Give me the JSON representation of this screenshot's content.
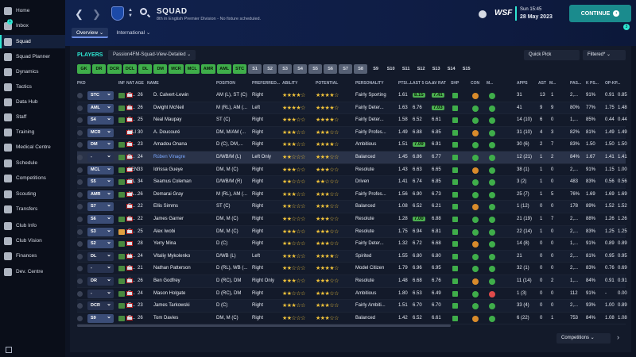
{
  "sidebar": {
    "items": [
      {
        "label": "Home"
      },
      {
        "label": "Inbox"
      },
      {
        "label": "Squad"
      },
      {
        "label": "Squad Planner"
      },
      {
        "label": "Dynamics"
      },
      {
        "label": "Tactics"
      },
      {
        "label": "Data Hub"
      },
      {
        "label": "Staff"
      },
      {
        "label": "Training"
      },
      {
        "label": "Medical Centre"
      },
      {
        "label": "Schedule"
      },
      {
        "label": "Competitions"
      },
      {
        "label": "Scouting"
      },
      {
        "label": "Transfers"
      },
      {
        "label": "Club Info"
      },
      {
        "label": "Club Vision"
      },
      {
        "label": "Finances"
      },
      {
        "label": "Dev. Centre"
      }
    ],
    "active": "Squad",
    "inbox_badge": "1"
  },
  "header": {
    "title": "SQUAD",
    "subtitle": "8th in English Premier Division - No fixture scheduled.",
    "tabs": [
      {
        "label": "Overview ⌄"
      },
      {
        "label": "International ⌄"
      }
    ],
    "logo_text": "WSF",
    "date_time": "Sun 15:45",
    "date": "28 May 2023",
    "continue_label": "CONTINUE",
    "notif_count": "3"
  },
  "toolbar": {
    "players_label": "PLAYERS",
    "view_name": "Passion4FM-Squad-View-Detailed ⌄",
    "quick_pick": "Quick Pick",
    "filtered": "Filtered* ⌄"
  },
  "position_chips": [
    "GK",
    "DR",
    "DCR",
    "DCL",
    "DL",
    "DM",
    "MCR",
    "MCL",
    "AMR",
    "AML",
    "STC",
    "S1",
    "S2",
    "S3",
    "S4",
    "S5",
    "S6",
    "S7",
    "S8",
    "S9",
    "S10",
    "S11",
    "S12",
    "S13",
    "S14",
    "S15"
  ],
  "columns": [
    "PKD",
    "INF",
    "NAT",
    "AGE",
    "NAME",
    "POSITION",
    "PREFERRED...",
    "ABILITY",
    "POTENTIAL",
    "PERSONALITY",
    "PTS/...",
    "LAST 5 GA...",
    "AV RAT",
    "SHP",
    "CON",
    "M...",
    "APPS",
    "AST",
    "M...",
    "PAS...",
    "K PS...",
    "OP-KP..."
  ],
  "players": [
    {
      "pkd": "STC",
      "nat": "E...",
      "age": "26",
      "name": "D. Calvert-Lewin",
      "pos": "AM (L), ST (C)",
      "foot": "Right",
      "abil": "★★★★☆",
      "pot": "★★★★☆",
      "pers": "Fairly Sporting",
      "pts": "1.61",
      "last5": "8.15",
      "avr": "7.41",
      "apps": "31",
      "ast": "13",
      "m": "1",
      "pas": "2,...",
      "kps": "91%",
      "op": "0.91",
      "op2": "0.85"
    },
    {
      "pkd": "AML",
      "nat": "E...",
      "age": "26",
      "name": "Dwight McNeil",
      "pos": "M (RL), AM (...",
      "foot": "Left",
      "abil": "★★★★☆",
      "pot": "★★★★☆",
      "pers": "Fairly Deter...",
      "pts": "1.63",
      "last5": "6.76",
      "avr": "7.03",
      "apps": "41",
      "ast": "9",
      "m": "9",
      "pas": "80%",
      "kps": "77%",
      "op": "1.75",
      "op2": "1.48"
    },
    {
      "pkd": "S4",
      "nat": "E...",
      "age": "25",
      "name": "Neal Maupay",
      "pos": "ST (C)",
      "foot": "Right",
      "abil": "★★★☆☆",
      "pot": "★★★★☆",
      "pers": "Fairly Deter...",
      "pts": "1.58",
      "last5": "6.52",
      "avr": "6.61",
      "apps": "14 (10)",
      "ast": "6",
      "m": "0",
      "pas": "1,...",
      "kps": "85%",
      "op": "0.44",
      "op2": "0.44"
    },
    {
      "pkd": "MCR",
      "nat": "MLI",
      "age": "30",
      "name": "A. Doucouré",
      "pos": "DM, M/AM (...",
      "foot": "Right",
      "abil": "★★★☆☆",
      "pot": "★★★☆☆",
      "pers": "Fairly Profes...",
      "pts": "1.49",
      "last5": "6.88",
      "avr": "6.85",
      "apps": "31 (10)",
      "ast": "4",
      "m": "3",
      "pas": "82%",
      "kps": "81%",
      "op": "1.49",
      "op2": "1.49"
    },
    {
      "pkd": "DM",
      "nat": "E...",
      "age": "23",
      "name": "Amadou Onana",
      "pos": "D (C), DM,...",
      "foot": "Right",
      "abil": "★★★☆☆",
      "pot": "★★★★☆",
      "pers": "Ambitious",
      "pts": "1.51",
      "last5": "7.09",
      "avr": "6.91",
      "apps": "30 (6)",
      "ast": "2",
      "m": "7",
      "pas": "83%",
      "kps": "1.50",
      "op": "1.50",
      "op2": "1.50"
    },
    {
      "pkd": "-",
      "nat": "P...",
      "age": "24",
      "name": "Rúben Vinagre",
      "pos": "D/WB/M (L)",
      "foot": "Left Only",
      "abil": "★★☆☆☆",
      "pot": "★★★☆☆",
      "pers": "Balanced",
      "pts": "1.45",
      "last5": "6.86",
      "avr": "6.77",
      "apps": "12 (21)",
      "ast": "1",
      "m": "2",
      "pas": "84%",
      "kps": "1.67",
      "op": "1.41",
      "op2": "1.41"
    },
    {
      "pkd": "MCL",
      "nat": "SEN",
      "age": "33",
      "name": "Idrissa Gueye",
      "pos": "DM, M (C)",
      "foot": "Right",
      "abil": "★★★☆☆",
      "pot": "★★★☆☆",
      "pers": "Resolute",
      "pts": "1.43",
      "last5": "6.63",
      "avr": "6.65",
      "apps": "38 (1)",
      "ast": "1",
      "m": "0",
      "pas": "2,...",
      "kps": "91%",
      "op": "1.15",
      "op2": "1.00"
    },
    {
      "pkd": "S5",
      "nat": "IRL",
      "age": "34",
      "name": "Seamus Coleman",
      "pos": "D/WB/M (R)",
      "foot": "Right",
      "abil": "★★☆☆☆",
      "pot": "★★☆☆☆",
      "pers": "Driven",
      "pts": "1.41",
      "last5": "6.74",
      "avr": "6.85",
      "apps": "3 (2)",
      "ast": "1",
      "m": "0",
      "pas": "483",
      "kps": "83%",
      "op": "0.56",
      "op2": "0.56"
    },
    {
      "pkd": "AMR",
      "nat": "JA...",
      "age": "26",
      "name": "Demarai Gray",
      "pos": "M (RL), AM (...",
      "foot": "Right",
      "abil": "★★★☆☆",
      "pot": "★★★☆☆",
      "pers": "Fairly Profes...",
      "pts": "1.56",
      "last5": "6.90",
      "avr": "6.73",
      "apps": "25 (7)",
      "ast": "1",
      "m": "5",
      "pas": "76%",
      "kps": "1.69",
      "op": "1.69",
      "op2": "1.69"
    },
    {
      "pkd": "S7",
      "nat": "E...",
      "age": "22",
      "name": "Ellis Simms",
      "pos": "ST (C)",
      "foot": "Right",
      "abil": "★★☆☆☆",
      "pot": "★★★☆☆",
      "pers": "Balanced",
      "pts": "1.08",
      "last5": "6.52",
      "avr": "6.21",
      "apps": "1 (12)",
      "ast": "0",
      "m": "0",
      "pas": "178",
      "kps": "89%",
      "op": "1.52",
      "op2": "1.52"
    },
    {
      "pkd": "S6",
      "nat": "E...",
      "age": "22",
      "name": "James Garner",
      "pos": "DM, M (C)",
      "foot": "Right",
      "abil": "★★☆☆☆",
      "pot": "★★★☆☆",
      "pers": "Resolute",
      "pts": "1.28",
      "last5": "7.00",
      "avr": "6.88",
      "apps": "21 (19)",
      "ast": "1",
      "m": "7",
      "pas": "2,...",
      "kps": "88%",
      "op": "1.26",
      "op2": "1.26"
    },
    {
      "pkd": "S3",
      "nat": "E...",
      "age": "25",
      "name": "Alex Iwobi",
      "pos": "DM, M (C)",
      "foot": "Right",
      "abil": "★★★☆☆",
      "pot": "★★★☆☆",
      "pers": "Resolute",
      "pts": "1.75",
      "last5": "6.94",
      "avr": "6.81",
      "apps": "22 (14)",
      "ast": "1",
      "m": "0",
      "pas": "2,...",
      "kps": "83%",
      "op": "1.25",
      "op2": "1.25"
    },
    {
      "pkd": "S2",
      "nat": "...",
      "age": "28",
      "name": "Yerry Mina",
      "pos": "D (C)",
      "foot": "Right",
      "abil": "★★☆☆☆",
      "pot": "★★★☆☆",
      "pers": "Fairly Deter...",
      "pts": "1.32",
      "last5": "6.72",
      "avr": "6.68",
      "apps": "14 (8)",
      "ast": "0",
      "m": "0",
      "pas": "1,...",
      "kps": "91%",
      "op": "0.89",
      "op2": "0.89"
    },
    {
      "pkd": "DL",
      "nat": "U...",
      "age": "24",
      "name": "Vitaliy Mykolenko",
      "pos": "D/WB (L)",
      "foot": "Left",
      "abil": "★★★☆☆",
      "pot": "★★★★☆",
      "pers": "Spirited",
      "pts": "1.55",
      "last5": "6.80",
      "avr": "6.80",
      "apps": "21",
      "ast": "0",
      "m": "0",
      "pas": "2,...",
      "kps": "81%",
      "op": "0.95",
      "op2": "0.95"
    },
    {
      "pkd": "-",
      "nat": "S...",
      "age": "21",
      "name": "Nathan Patterson",
      "pos": "D (RL), WB (...",
      "foot": "Right",
      "abil": "★★☆☆☆",
      "pot": "★★★★☆",
      "pers": "Model Citizen",
      "pts": "1.79",
      "last5": "6.96",
      "avr": "6.95",
      "apps": "32 (1)",
      "ast": "0",
      "m": "0",
      "pas": "2,...",
      "kps": "83%",
      "op": "0.76",
      "op2": "0.69"
    },
    {
      "pkd": "DR",
      "nat": "E...",
      "age": "26",
      "name": "Ben Godfrey",
      "pos": "D (RC), DM",
      "foot": "Right Only",
      "abil": "★★★☆☆",
      "pot": "★★★☆☆",
      "pers": "Resolute",
      "pts": "1.48",
      "last5": "6.68",
      "avr": "6.76",
      "apps": "11 (14)",
      "ast": "0",
      "m": "2",
      "pas": "1,...",
      "kps": "84%",
      "op": "0.91",
      "op2": "0.91"
    },
    {
      "pkd": "-",
      "nat": "E...",
      "age": "24",
      "name": "Mason Holgate",
      "pos": "D (RC), DM",
      "foot": "Right",
      "abil": "★★☆☆☆",
      "pot": "★★★☆☆",
      "pers": "Ambitious",
      "pts": "1.80",
      "last5": "6.53",
      "avr": "6.49",
      "apps": "1 (3)",
      "ast": "0",
      "m": "0",
      "pas": "112",
      "kps": "91%",
      "op": "-",
      "op2": "0.00"
    },
    {
      "pkd": "DCR",
      "nat": "E...",
      "age": "23",
      "name": "James Tarkowski",
      "pos": "D (C)",
      "foot": "Right",
      "abil": "★★★☆☆",
      "pot": "★★★☆☆",
      "pers": "Fairly Ambiti...",
      "pts": "1.51",
      "last5": "6.70",
      "avr": "6.70",
      "apps": "33 (4)",
      "ast": "0",
      "m": "0",
      "pas": "2,...",
      "kps": "93%",
      "op": "1.00",
      "op2": "0.89"
    },
    {
      "pkd": "S9",
      "nat": "E...",
      "age": "26",
      "name": "Tom Davies",
      "pos": "DM, M (C)",
      "foot": "Right",
      "abil": "★★☆☆☆",
      "pot": "★★★☆☆",
      "pers": "Balanced",
      "pts": "1.42",
      "last5": "6.52",
      "avr": "6.61",
      "apps": "6 (22)",
      "ast": "0",
      "m": "1",
      "pas": "753",
      "kps": "84%",
      "op": "1.08",
      "op2": "1.08"
    }
  ],
  "footer": {
    "competitions_dd": "Competitions ⌄",
    "next_arrow": "›"
  },
  "colors": {
    "accent": "#2ee6d2",
    "continue": "#1a8b8d",
    "position_chip": "#3fae4a"
  }
}
